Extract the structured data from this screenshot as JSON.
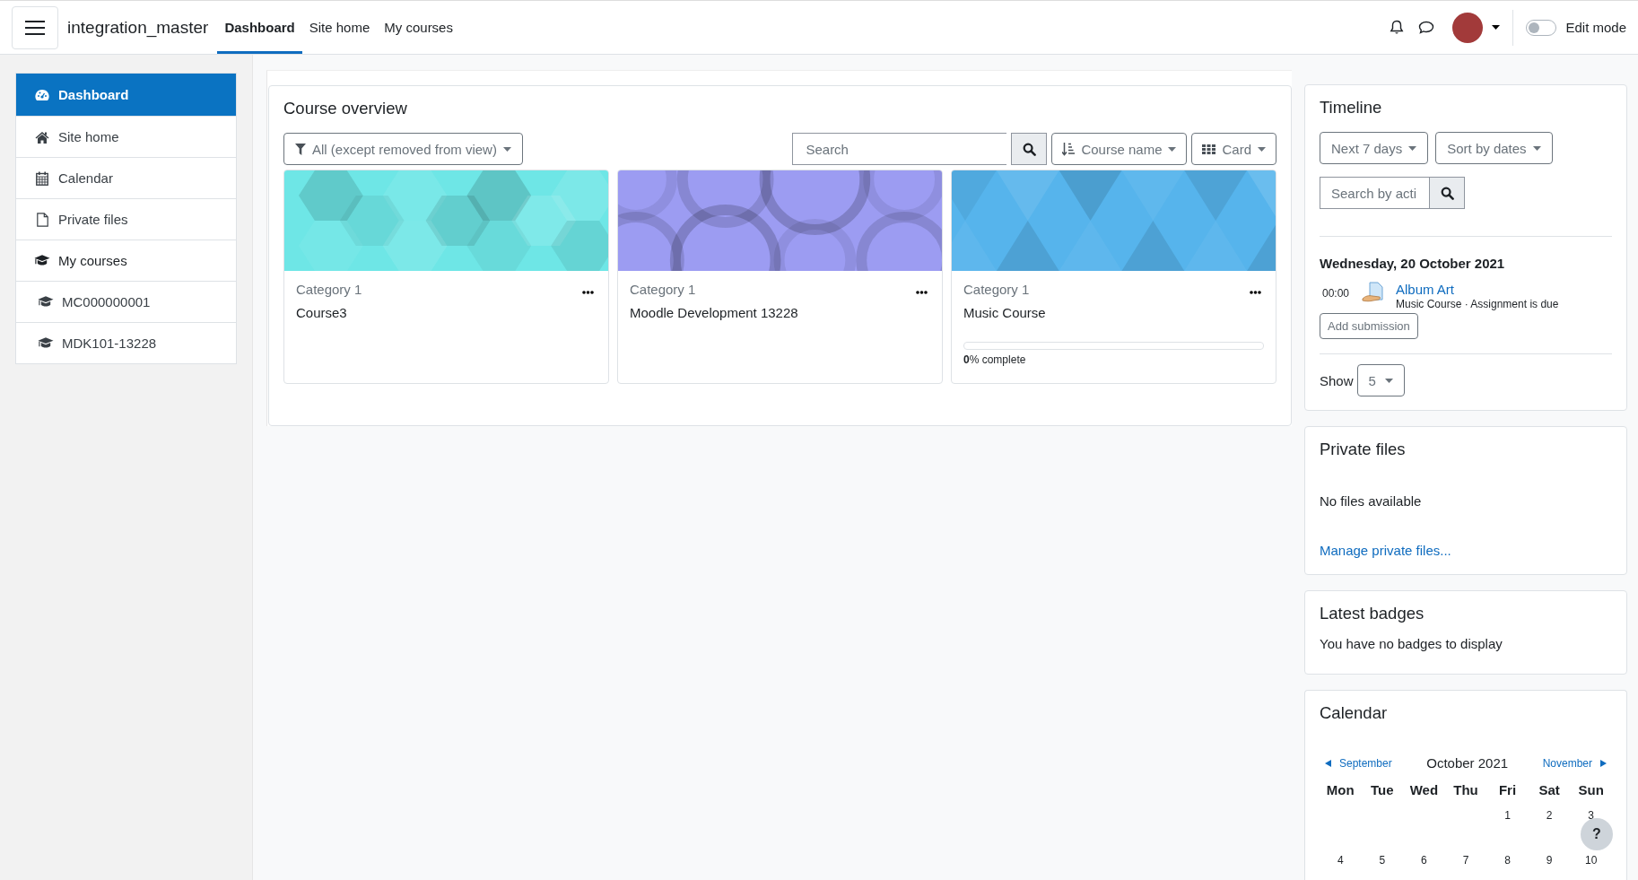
{
  "navbar": {
    "brand": "integration_master",
    "nav_items": [
      {
        "label": "Dashboard",
        "selected": true
      },
      {
        "label": "Site home",
        "selected": false
      },
      {
        "label": "My courses",
        "selected": false
      }
    ],
    "edit_mode": {
      "label": "Edit mode",
      "on": false
    }
  },
  "sidebar": {
    "items": [
      {
        "kind": "dashboard",
        "label": "Dashboard",
        "selected": true
      },
      {
        "kind": "home",
        "label": "Site home",
        "selected": false
      },
      {
        "kind": "calendar",
        "label": "Calendar",
        "selected": false
      },
      {
        "kind": "file",
        "label": "Private files",
        "selected": false
      },
      {
        "kind": "courses",
        "label": "My courses",
        "selected": false,
        "children": [
          {
            "kind": "course",
            "label": "MC000000001",
            "selected": false
          },
          {
            "kind": "course",
            "label": "MDK101-13228",
            "selected": false
          }
        ]
      }
    ]
  },
  "course_overview": {
    "title": "Course overview",
    "filter": "All (except removed from view)",
    "search": {
      "placeholder": "Search"
    },
    "sort": "Course name",
    "view": "Card",
    "courses": [
      {
        "kind": "hexagons",
        "color": "#6ee6e6",
        "category": "Category 1",
        "name": "Course3"
      },
      {
        "kind": "circles",
        "color": "#9c9cf2",
        "category": "Category 1",
        "name": "Moodle Development 13228"
      },
      {
        "kind": "triangles",
        "color": "#56b4ec",
        "category": "Category 1",
        "name": "Music Course",
        "progress": {
          "level": 0,
          "reading": "**0**% complete"
        }
      }
    ]
  },
  "timeline": {
    "title": "Timeline",
    "range": "Next 7 days",
    "sort": "Sort by dates",
    "search": {
      "placeholder": "Search by acti"
    },
    "groups": [
      {
        "date": "Wednesday, 20 October 2021",
        "events": [
          {
            "time": "00:00",
            "name": "Album Art",
            "meta": "Music Course · Assignment is due",
            "action": "Add submission"
          }
        ]
      }
    ],
    "show_label": "Show",
    "show_value": "5"
  },
  "private_files": {
    "title": "Private files",
    "message": "No files available",
    "link": "Manage private files..."
  },
  "latest_badges": {
    "title": "Latest badges",
    "message": "You have no badges to display"
  },
  "calendar": {
    "title": "Calendar",
    "previous": "September",
    "month": "October 2021",
    "next": "November",
    "weekdays": [
      "Mon",
      "Tue",
      "Wed",
      "Thu",
      "Fri",
      "Sat",
      "Sun"
    ],
    "weeks": [
      [
        "1",
        "2",
        "3"
      ],
      [
        "4",
        "5",
        "6",
        "7",
        "8",
        "9",
        "10"
      ]
    ]
  },
  "help_button": {
    "label": "?"
  }
}
